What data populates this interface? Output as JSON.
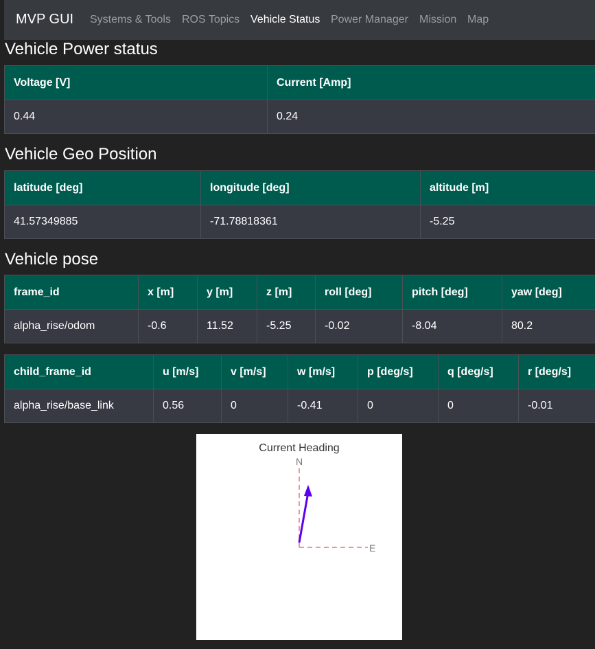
{
  "navbar": {
    "brand": "MVP GUI",
    "links": [
      "Systems & Tools",
      "ROS Topics",
      "Vehicle Status",
      "Power Manager",
      "Mission",
      "Map"
    ],
    "active": "Vehicle Status"
  },
  "power": {
    "title": "Vehicle Power status",
    "headers": [
      "Voltage [V]",
      "Current [Amp]"
    ],
    "row": [
      "0.44",
      "0.24"
    ]
  },
  "geo": {
    "title": "Vehicle Geo Position",
    "headers": [
      "latitude [deg]",
      "longitude [deg]",
      "altitude [m]"
    ],
    "row": [
      "41.57349885",
      "-71.78818361",
      "-5.25"
    ]
  },
  "pose": {
    "title": "Vehicle pose",
    "headers": [
      "frame_id",
      "x [m]",
      "y [m]",
      "z [m]",
      "roll [deg]",
      "pitch [deg]",
      "yaw [deg]"
    ],
    "row": [
      "alpha_rise/odom",
      "-0.6",
      "11.52",
      "-5.25",
      "-0.02",
      "-8.04",
      "80.2"
    ]
  },
  "velocity": {
    "headers": [
      "child_frame_id",
      "u [m/s]",
      "v [m/s]",
      "w [m/s]",
      "p [deg/s]",
      "q [deg/s]",
      "r [deg/s]"
    ],
    "row": [
      "alpha_rise/base_link",
      "0.56",
      "0",
      "-0.41",
      "0",
      "0",
      "-0.01"
    ]
  },
  "heading_plot": {
    "title": "Current Heading",
    "north_label": "N",
    "east_label": "E",
    "heading_deg": 80.2,
    "arrow_color": "#5b00f0",
    "axis_color": "#f07070"
  }
}
